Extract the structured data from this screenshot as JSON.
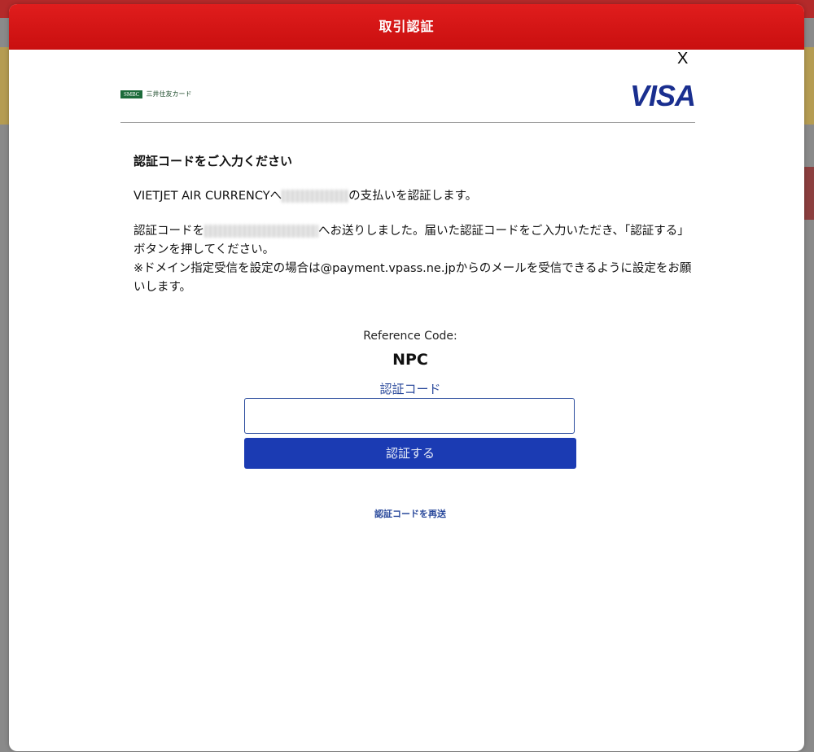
{
  "modal": {
    "title": "取引認証",
    "close_label": "X",
    "brand": {
      "issuer_badge": "SMBC",
      "issuer_name": "三井住友カード",
      "network": "VISA"
    },
    "heading": "認証コードをご入力ください",
    "payment_prefix": "VIETJET AIR CURRENCYへ",
    "payment_suffix": "の支払いを認証します。",
    "sent_prefix": "認証コードを",
    "sent_suffix": "へお送りしました。届いた認証コードをご入力いただき、「認証する」ボタンを押してください。",
    "domain_note": "※ドメイン指定受信を設定の場合は@payment.vpass.ne.jpからのメールを受信できるように設定をお願いします。",
    "reference_label": "Reference Code:",
    "reference_code": "NPC",
    "code_field_label": "認証コード",
    "code_field_value": "",
    "submit_label": "認証する",
    "resend_label": "認証コードを再送"
  },
  "colors": {
    "header_red": "#d81616",
    "primary_blue": "#1b3bb3",
    "link_blue": "#2b4a9c",
    "visa_blue": "#1a2f8f",
    "smbc_green": "#1c6b3a"
  }
}
